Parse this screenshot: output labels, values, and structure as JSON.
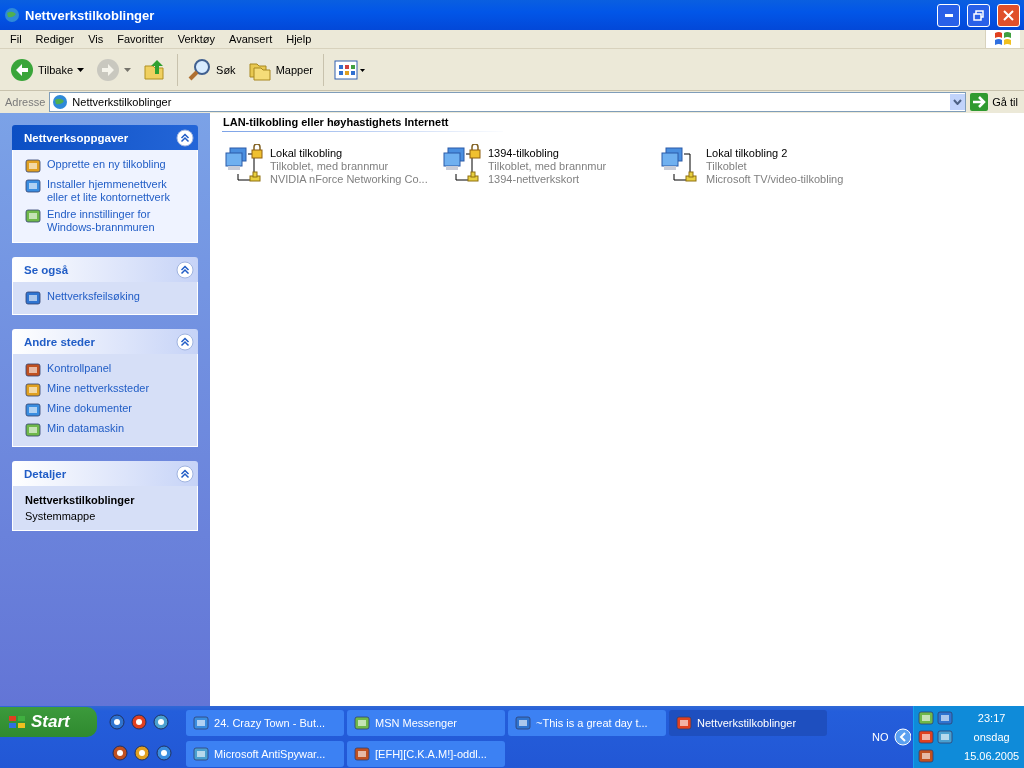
{
  "window": {
    "title": "Nettverkstilkoblinger"
  },
  "menu": [
    "Fil",
    "Rediger",
    "Vis",
    "Favoritter",
    "Verktøy",
    "Avansert",
    "Hjelp"
  ],
  "toolbar": [
    {
      "kind": "back",
      "label": "Tilbake",
      "disabled": false
    },
    {
      "kind": "forward",
      "disabled": true
    },
    {
      "kind": "up"
    },
    {
      "kind": "search",
      "label": "Søk"
    },
    {
      "kind": "folders",
      "label": "Mapper"
    },
    {
      "kind": "views"
    }
  ],
  "address": {
    "label": "Adresse",
    "value": "Nettverkstilkoblinger",
    "go_label": "Gå til"
  },
  "sidebar": {
    "panels": [
      {
        "kind": "tasks",
        "special": true,
        "title": "Nettverksoppgaver",
        "items": [
          "Opprette en ny tilkobling",
          "Installer hjemmenettverk eller et lite kontornettverk",
          "Endre innstillinger for Windows-brannmuren"
        ]
      },
      {
        "kind": "tasks",
        "special": false,
        "title": "Se også",
        "items": [
          "Nettverksfeilsøking"
        ]
      },
      {
        "kind": "tasks",
        "special": false,
        "title": "Andre steder",
        "items": [
          "Kontrollpanel",
          "Mine nettverkssteder",
          "Mine dokumenter",
          "Min datamaskin"
        ]
      },
      {
        "kind": "details",
        "special": false,
        "title": "Detaljer",
        "name": "Nettverkstilkoblinger",
        "description": "Systemmappe"
      }
    ]
  },
  "content": {
    "group_title": "LAN-tilkobling eller høyhastighets Internett",
    "connections": [
      {
        "name": "Lokal tilkobling",
        "status": "Tilkoblet, med brannmur",
        "device": "NVIDIA nForce Networking Co...",
        "firewall": true
      },
      {
        "name": "1394-tilkobling",
        "status": "Tilkoblet, med brannmur",
        "device": "1394-nettverkskort",
        "firewall": true
      },
      {
        "name": "Lokal tilkobling 2",
        "status": "Tilkoblet",
        "device": "Microsoft TV/video-tilkobling",
        "firewall": false
      }
    ]
  },
  "taskbar": {
    "start_label": "Start",
    "tasks": [
      {
        "label": "24. Crazy Town - But...",
        "selected": false
      },
      {
        "label": "MSN Messenger",
        "selected": false
      },
      {
        "label": "~This is a great day t...",
        "selected": false
      },
      {
        "label": "Nettverkstilkoblinger",
        "selected": true
      },
      {
        "label": "Microsoft AntiSpywar...",
        "selected": false
      },
      {
        "label": "[EFH][C.K.A.M!]-oddl...",
        "selected": false
      }
    ],
    "language": "NO",
    "clock": {
      "time": "23:17",
      "day": "onsdag",
      "date": "15.06.2005"
    }
  }
}
